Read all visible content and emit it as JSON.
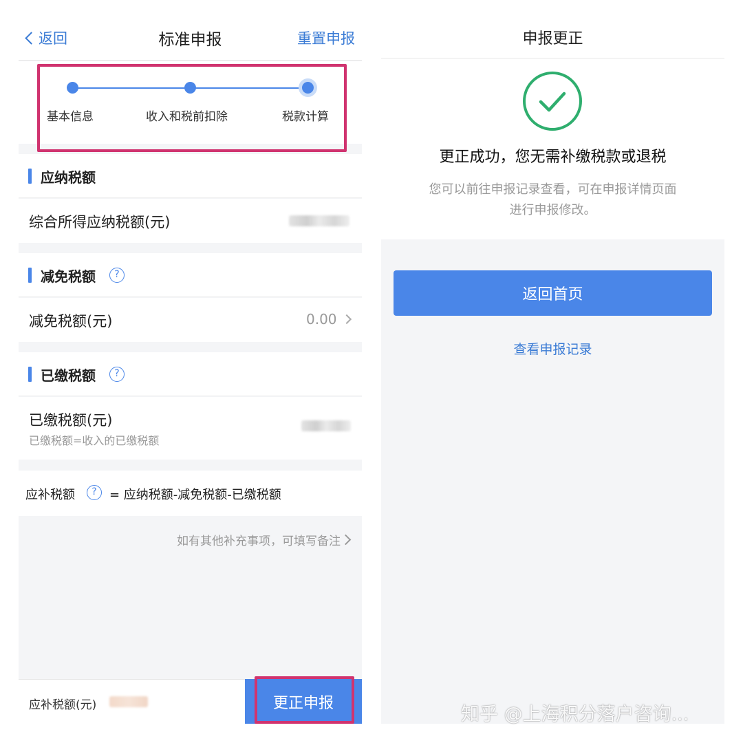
{
  "left": {
    "nav": {
      "back_label": "返回",
      "title": "标准申报",
      "reset_label": "重置申报"
    },
    "steps": [
      {
        "label": "基本信息"
      },
      {
        "label": "收入和税前扣除"
      },
      {
        "label": "税款计算"
      }
    ],
    "sections": {
      "payable": {
        "title": "应纳税额",
        "row_label": "综合所得应纳税额(元)"
      },
      "reduction": {
        "title": "减免税额",
        "row_label": "减免税额(元)",
        "row_value": "0.00"
      },
      "paid": {
        "title": "已缴税额",
        "row_label": "已缴税额(元)",
        "row_sub": "已缴税额=收入的已缴税额"
      }
    },
    "formula": {
      "label": "应补税额",
      "expression": "= 应纳税额-减免税额-已缴税额"
    },
    "help_glyph": "?",
    "remark": "如有其他补充事项，可填写备注",
    "footer": {
      "label": "应补税额(元)",
      "submit_label": "更正申报"
    }
  },
  "right": {
    "title": "申报更正",
    "headline": "更正成功，您无需补缴税款或退税",
    "desc_line1": "您可以前往申报记录查看，可在申报详情页面",
    "desc_line2": "进行申报修改。",
    "home_button": "返回首页",
    "record_link": "查看申报记录"
  },
  "watermark": "知乎 @上海积分落户咨询...",
  "colors": {
    "accent": "#4a86e8",
    "highlight": "#d0336f",
    "success": "#2fae6e"
  }
}
